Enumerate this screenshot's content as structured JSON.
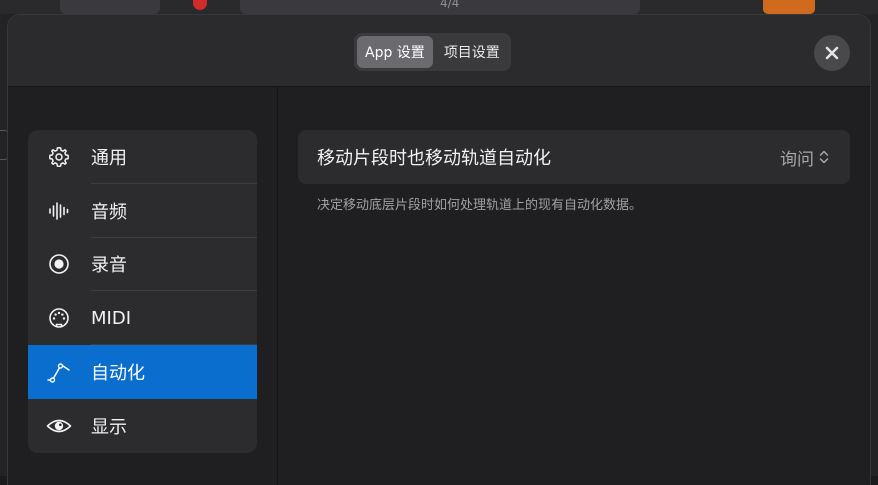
{
  "background": {
    "time_signature": "4/4"
  },
  "header": {
    "segmented": [
      {
        "label": "App 设置",
        "active": true
      },
      {
        "label": "项目设置",
        "active": false
      }
    ],
    "close_icon": "close-icon"
  },
  "sidebar": {
    "items": [
      {
        "label": "通用",
        "icon": "gear-icon",
        "selected": false
      },
      {
        "label": "音频",
        "icon": "waveform-icon",
        "selected": false
      },
      {
        "label": "录音",
        "icon": "record-icon",
        "selected": false
      },
      {
        "label": "MIDI",
        "icon": "midi-icon",
        "selected": false
      },
      {
        "label": "自动化",
        "icon": "automation-icon",
        "selected": true
      },
      {
        "label": "显示",
        "icon": "eye-icon",
        "selected": false
      }
    ]
  },
  "main": {
    "setting": {
      "label": "移动片段时也移动轨道自动化",
      "value": "询问",
      "value_icon": "chevron-up-down-icon"
    },
    "description": "决定移动底层片段时如何处理轨道上的现有自动化数据。"
  },
  "colors": {
    "accent": "#0a6ecf",
    "sheet_bg": "#1f1f21",
    "card_bg": "#2c2c2e"
  }
}
